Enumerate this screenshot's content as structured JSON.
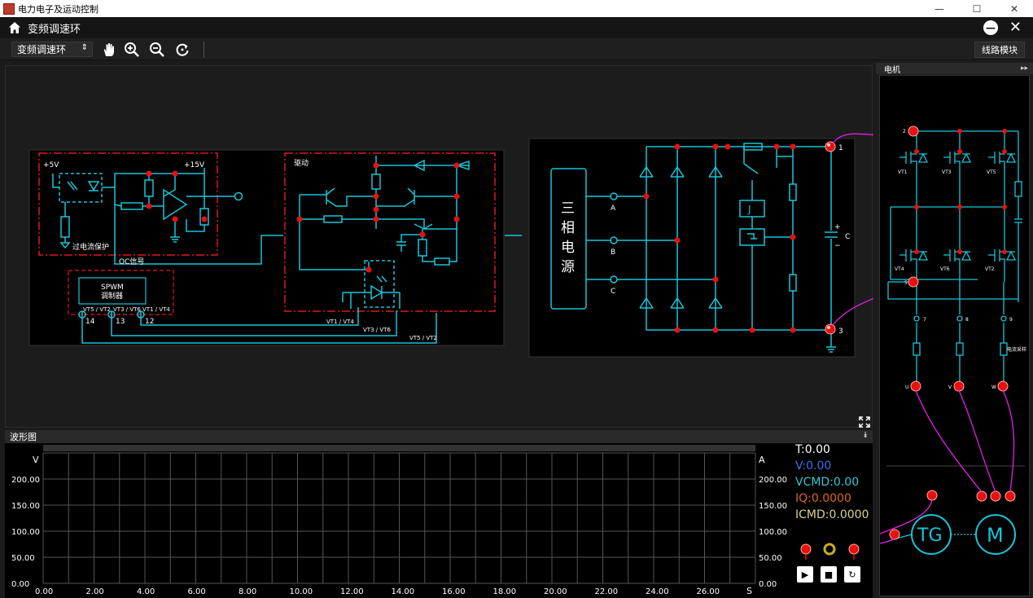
{
  "window": {
    "title": "电力电子及运动控制"
  },
  "app": {
    "page_title": "变频调速环"
  },
  "toolbar": {
    "selected_mode": "变频调速环",
    "module_button": "线路模块"
  },
  "circuit": {
    "labels": {
      "p5v": "+5V",
      "p15v": "+15V",
      "overcurrent": "过电流保护",
      "oc_signal": "OC信号",
      "spwm": "SPWM",
      "modulator": "调制器",
      "drive": "驱动",
      "vt5_vt2": "VT5 / VT2",
      "vt3_vt6": "VT3 / VT6",
      "vt1_vt4": "VT1 / VT4",
      "p14": "14",
      "p13": "13",
      "p12": "12",
      "bus_vt14": "VT1 / VT4",
      "bus_vt36": "VT3 / VT6",
      "bus_vt52": "VT5 / VT2",
      "three_phase": [
        "三",
        "相",
        "电",
        "源"
      ],
      "phase_a": "A",
      "phase_b": "B",
      "phase_c": "C",
      "relay_j": "J",
      "cap_c": "C",
      "cap_plus": "+",
      "cap_minus": "−",
      "node1": "1",
      "node3": "3"
    }
  },
  "side_panel": {
    "title": "电机",
    "labels": {
      "vt1": "VT1",
      "vt3": "VT3",
      "vt5": "VT5",
      "vt4": "VT4",
      "vt6": "VT6",
      "vt2": "VT2",
      "n2": "2",
      "n5": "5",
      "n7": "7",
      "n8": "8",
      "n9": "9",
      "current_sample": "电流采样",
      "u": "U",
      "v": "V",
      "w": "W",
      "tg": "TG",
      "m": "M"
    }
  },
  "waveform": {
    "title": "波形图",
    "left_unit": "V",
    "right_unit": "A",
    "x_unit": "S",
    "y_ticks": [
      "200.00",
      "150.00",
      "100.00",
      "50.00",
      "0.00"
    ],
    "x_ticks": [
      "0.00",
      "2.00",
      "4.00",
      "6.00",
      "8.00",
      "10.00",
      "12.00",
      "14.00",
      "16.00",
      "18.00",
      "20.00",
      "22.00",
      "24.00",
      "26.00"
    ]
  },
  "readouts": {
    "t": "T:0.00",
    "v": "V:0.00",
    "vcmd": "VCMD:0.00",
    "iq": "IQ:0.0000",
    "icmd": "ICMD:0.0000"
  },
  "colors": {
    "circuit": "#17c5d9",
    "red_frame": "#e01818",
    "node": "#e81010",
    "wire": "#e61fe6",
    "t_color": "#ffffff",
    "v_color": "#3b6ff0",
    "vcmd_color": "#35c8d6",
    "iq_color": "#e0651a",
    "icmd_color": "#d9d28a"
  }
}
